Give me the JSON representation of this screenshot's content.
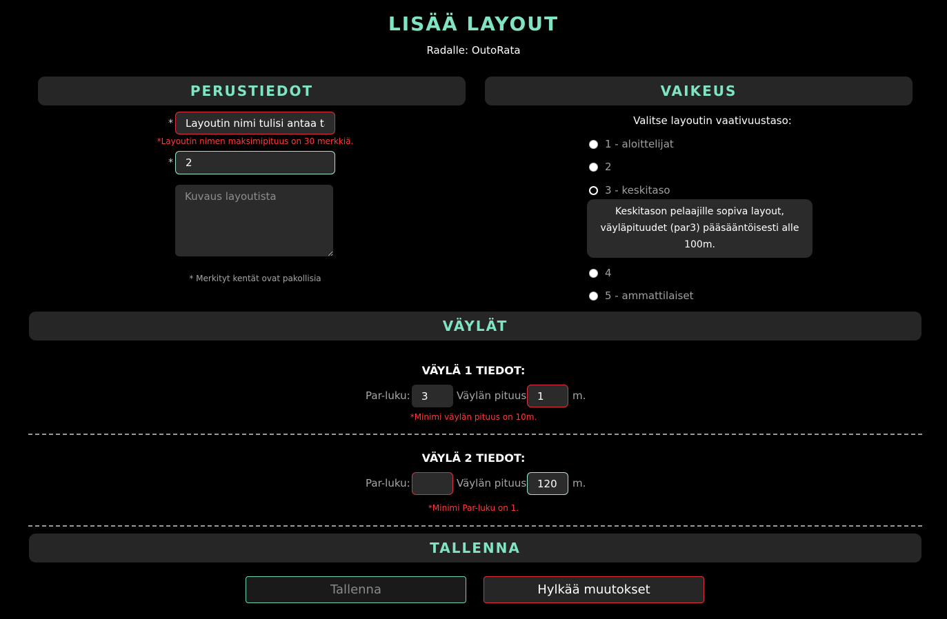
{
  "page": {
    "title": "LISÄÄ LAYOUT",
    "subtitle": "Radalle: OutoRata"
  },
  "basic_info": {
    "header": "PERUSTIEDOT",
    "required_mark": "*",
    "name_value": "Layoutin nimi tulisi antaa täh",
    "name_error": "*Layoutin nimen maksimipituus on 30 merkkiä.",
    "holes_count_value": "2",
    "description_placeholder": "Kuvaus layoutista",
    "required_note": "* Merkityt kentät ovat pakollisia"
  },
  "difficulty": {
    "header": "VAIKEUS",
    "prompt": "Valitse layoutin vaativuustaso:",
    "options": [
      "1 - aloittelijat",
      "2",
      "3 - keskitaso",
      "4",
      "5 - ammattilaiset"
    ],
    "selected": "3 - keskitaso",
    "tooltip": "Keskitason pelaajille sopiva layout, väyläpituudet (par3) pääsääntöisesti alle 100m."
  },
  "holes": {
    "header": "VÄYLÄT",
    "par_label": "Par-luku:",
    "length_label": "Väylän pituus:",
    "unit": "m.",
    "items": [
      {
        "title": "VÄYLÄ 1 TIEDOT:",
        "par": "3",
        "length": "1",
        "error": "*Minimi väylän pituus on 10m."
      },
      {
        "title": "VÄYLÄ 2 TIEDOT:",
        "par": "",
        "length": "120",
        "error": "*Minimi Par-luku on 1."
      }
    ]
  },
  "save": {
    "header": "TALLENNA",
    "save_label": "Tallenna",
    "discard_label": "Hylkää muutokset"
  },
  "colors": {
    "accent": "#7fe3c4",
    "error": "#ff3b3b",
    "panel": "#262626"
  }
}
